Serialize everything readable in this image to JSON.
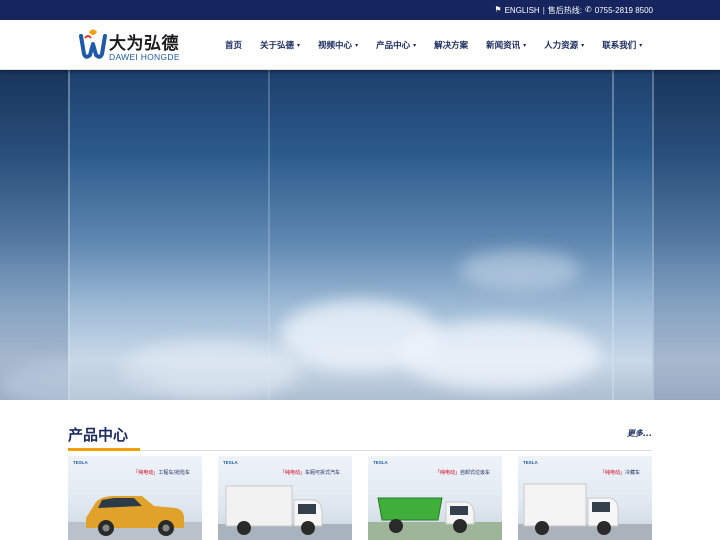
{
  "topbar": {
    "english_label": "ENGLISH",
    "separator": "|",
    "hotline_label": "售后热线:",
    "phone": "0755-2819 8500",
    "flag_icon": "flag-icon",
    "phone_icon": "phone-icon"
  },
  "logo": {
    "cn": "大为弘德",
    "en": "DAWEI HONGDE"
  },
  "nav": {
    "items": [
      {
        "label": "首页",
        "has_dropdown": false
      },
      {
        "label": "关于弘德",
        "has_dropdown": true
      },
      {
        "label": "视频中心",
        "has_dropdown": true
      },
      {
        "label": "产品中心",
        "has_dropdown": true
      },
      {
        "label": "解决方案",
        "has_dropdown": false
      },
      {
        "label": "新闻资讯",
        "has_dropdown": true
      },
      {
        "label": "人力资源",
        "has_dropdown": true
      },
      {
        "label": "联系我们",
        "has_dropdown": true
      }
    ],
    "chevron": "▾"
  },
  "products": {
    "title": "产品中心",
    "more": "更多...",
    "cards": [
      {
        "brand": "TESLA",
        "tag_highlight": "「纯电动」",
        "tag": "工程车/抢险车",
        "vehicle_color": "#e0a22a"
      },
      {
        "brand": "TESLA",
        "tag_highlight": "「纯电动」",
        "tag": "车厢可拆式汽车",
        "vehicle_color": "#f2f2f2"
      },
      {
        "brand": "TESLA",
        "tag_highlight": "「纯电动」",
        "tag": "自卸式垃圾车",
        "vehicle_color": "#3fae3a"
      },
      {
        "brand": "TESLA",
        "tag_highlight": "「纯电动」",
        "tag": "冷藏车",
        "vehicle_color": "#f4f4f4"
      }
    ]
  },
  "colors": {
    "topbar": "#17255e",
    "nav_text": "#1a2a5e",
    "accent": "#f0a000"
  }
}
